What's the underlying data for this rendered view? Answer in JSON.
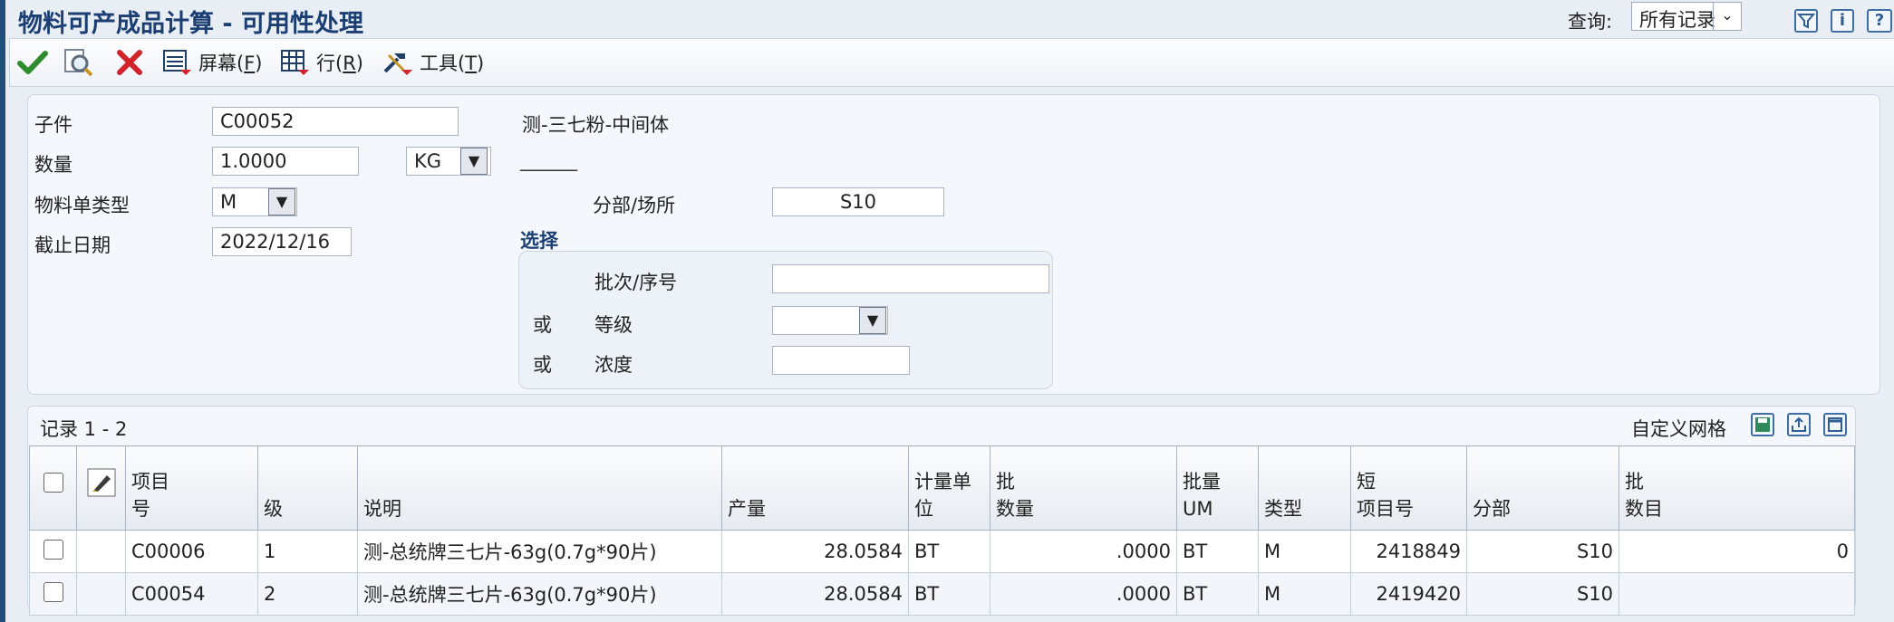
{
  "window": {
    "title": "物料可产成品计算 - 可用性处理"
  },
  "query": {
    "label": "查询:",
    "value": "所有记录"
  },
  "toolbar": {
    "screen": "屏幕(F)",
    "screen_a": "屏幕(",
    "screen_k": "F",
    "screen_b": ")",
    "row_a": "行(",
    "row_k": "R",
    "row_b": ")",
    "tools_a": "工具(",
    "tools_k": "T",
    "tools_b": ")"
  },
  "form": {
    "item_label": "子件",
    "item_value": "C00052",
    "item_desc": "测-三七粉-中间体",
    "qty_label": "数量",
    "qty_value": "1.0000",
    "uom_value": "KG",
    "uom_desc": "______",
    "bom_label": "物料单类型",
    "bom_value": "M",
    "cutoff_label": "截止日期",
    "cutoff_value": "2022/12/16",
    "branch_label": "分部/场所",
    "branch_value": "S10",
    "select_title": "选择",
    "lot_label": "批次/序号",
    "lot_value": "",
    "or1": "或",
    "grade_label": "等级",
    "grade_value": "",
    "or2": "或",
    "potency_label": "浓度",
    "potency_value": ""
  },
  "grid": {
    "records": "记录 1 - 2",
    "customize": "自定义网格",
    "headers": {
      "item_a": "项目",
      "item_b": "号",
      "level": "级",
      "desc": "说明",
      "yield": "产量",
      "uom_a": "计量单",
      "uom_b": "位",
      "batch_a": "批",
      "batch_b": "数量",
      "bum_a": "批量",
      "bum_b": "UM",
      "type": "类型",
      "short_a": "短",
      "short_b": "项目号",
      "branch": "分部",
      "num_a": "批",
      "num_b": "数目"
    },
    "rows": [
      {
        "item": "C00006",
        "level": "1",
        "desc": "测-总统牌三七片-63g(0.7g*90片)",
        "yield": "28.0584",
        "uom": "BT",
        "batch": ".0000",
        "bum": "BT",
        "type": "M",
        "short": "2418849",
        "branch": "S10",
        "num": "0"
      },
      {
        "item": "C00054",
        "level": "2",
        "desc": "测-总统牌三七片-63g(0.7g*90片)",
        "yield": "28.0584",
        "uom": "BT",
        "batch": ".0000",
        "bum": "BT",
        "type": "M",
        "short": "2419420",
        "branch": "S10",
        "num": ""
      }
    ]
  }
}
